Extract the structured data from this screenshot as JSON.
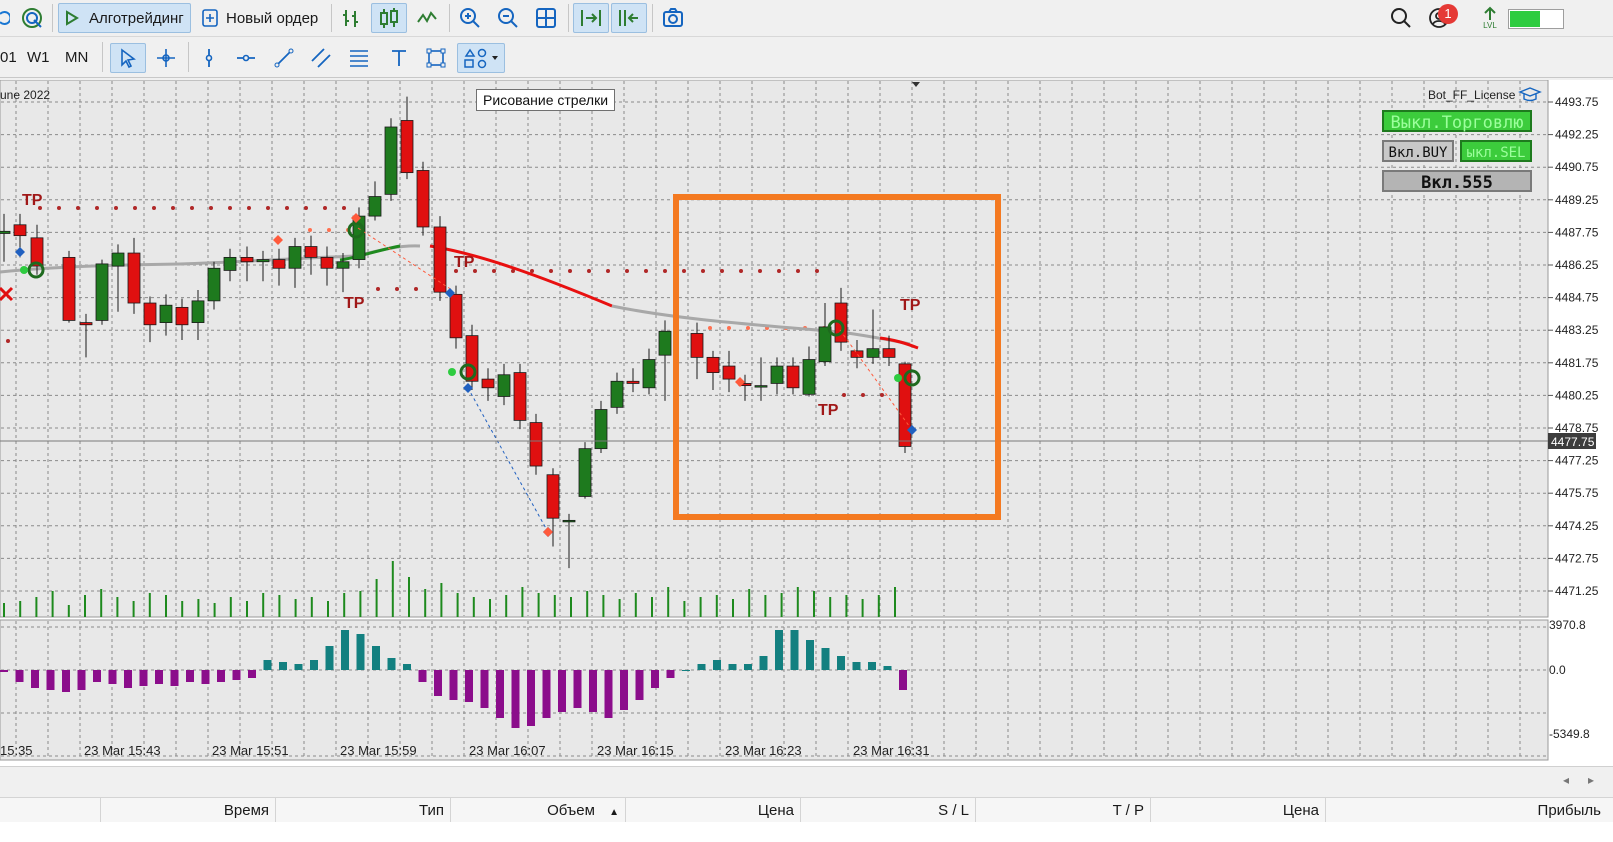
{
  "toolbar": {
    "algo_label": "Алготрейдинг",
    "new_order_label": "Новый ордер",
    "notification_count": "1",
    "lvl_label": "LVL"
  },
  "timeframes": [
    "01",
    "W1",
    "MN"
  ],
  "tooltip": "Рисование стрелки",
  "chart": {
    "title_fragment": "une 2022",
    "indicator_name": "Bot_FF_License",
    "current_price": "4477.75",
    "price_axis": [
      "4493.75",
      "4492.25",
      "4490.75",
      "4489.25",
      "4487.75",
      "4486.25",
      "4484.75",
      "4483.25",
      "4481.75",
      "4480.25",
      "4478.75",
      "4477.25",
      "4475.75",
      "4474.25",
      "4472.75",
      "4471.25"
    ],
    "osc_axis": [
      "3970.8",
      "0.0",
      "-5349.8"
    ],
    "time_axis": [
      "15:35",
      "23 Mar 15:43",
      "23 Mar 15:51",
      "23 Mar 15:59",
      "23 Mar 16:07",
      "23 Mar 16:15",
      "23 Mar 16:23",
      "23 Mar 16:31"
    ],
    "tp_label": "TP",
    "colors": {
      "bull": "#1e7a1e",
      "bear": "#e01010",
      "highlight": "#f47920",
      "osc_pos": "#138080",
      "osc_neg": "#8b0d8b"
    }
  },
  "bot_panel": {
    "trade_off": "Выкл.Торговлю",
    "buy_on": "Вкл.BUY",
    "sell_off": "ыкл.SEL",
    "magic": "Вкл.555"
  },
  "table_headers": {
    "time": "Время",
    "type": "Тип",
    "volume": "Объем",
    "price": "Цена",
    "sl": "S / L",
    "tp": "T / P",
    "price2": "Цена",
    "profit": "Прибыль"
  }
}
